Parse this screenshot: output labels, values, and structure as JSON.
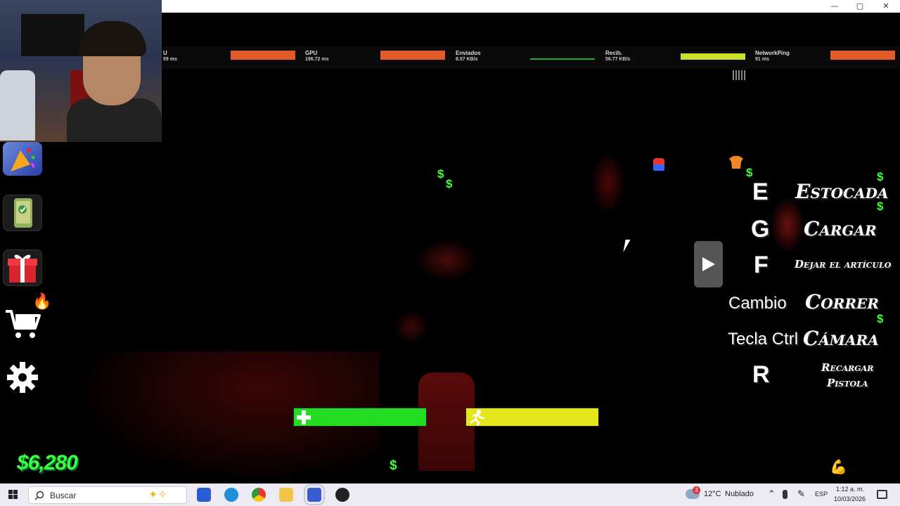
{
  "window": {
    "controls": [
      "—",
      "▢",
      "✕"
    ]
  },
  "stats": [
    {
      "label": "U",
      "value": "59 ms",
      "color": "#e05a2a"
    },
    {
      "label": "GPU",
      "value": "196.72 ms",
      "color": "#e05a2a"
    },
    {
      "label": "Enviados",
      "value": "8.57 KB/s",
      "color": "#2aa82a"
    },
    {
      "label": "Recib.",
      "value": "56.77 KB/s",
      "color": "#cbe02a"
    },
    {
      "label": "NetworkPing",
      "value": "91 ms",
      "color": "#e05a2a"
    }
  ],
  "hints": [
    {
      "key": "E",
      "action": "Estocada"
    },
    {
      "key": "G",
      "action": "Cargar"
    },
    {
      "key": "F",
      "action": "Dejar el artículo"
    },
    {
      "key": "Cambio",
      "action": "Correr"
    },
    {
      "key": "Tecla Ctrl",
      "action": "Cámara"
    },
    {
      "key": "R",
      "action_line1": "Recargar",
      "action_line2": "Pistola"
    }
  ],
  "money": "$6,280",
  "health_fraction": 1.0,
  "stamina_fraction": 1.0,
  "icons": {
    "party": "party-popper-icon",
    "phone": "phone-icon",
    "gift": "gift-icon",
    "cart": "shopping-cart-icon",
    "settings": "gear-icon",
    "fire": "fire-icon"
  },
  "colors": {
    "health": "#22dd22",
    "stamina": "#e5e51c",
    "money": "#3dff3d"
  },
  "taskbar": {
    "search_placeholder": "Buscar",
    "weather_temp": "12°C",
    "weather_desc": "Nublado",
    "weather_badge": "3",
    "language": "ESP",
    "time": "1:12 a. m.",
    "date": "10/03/2026"
  }
}
